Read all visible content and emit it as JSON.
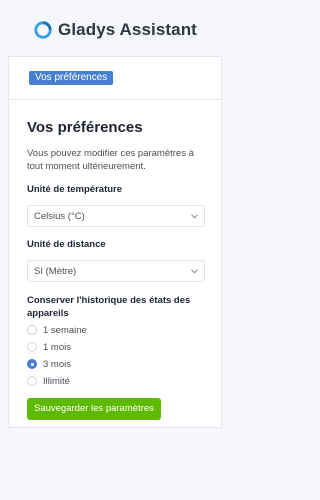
{
  "brand": {
    "name": "Gladys Assistant",
    "logo_icon": "gladys-logo-icon"
  },
  "header": {
    "badge": "Vos préférences"
  },
  "page": {
    "title": "Vos préférences",
    "description": "Vous pouvez modifier ces paramètres à tout moment ultérieurement."
  },
  "temperature": {
    "label": "Unité de température",
    "selected": "Celsius (°C)"
  },
  "distance": {
    "label": "Unité de distance",
    "selected": "SI (Mètre)"
  },
  "history": {
    "label": "Conserver l'historique des états des appareils",
    "options": [
      "1 semaine",
      "1 mois",
      "3 mois",
      "Illimité"
    ],
    "selected_index": 2
  },
  "save_label": "Sauvegarder les paramètres",
  "colors": {
    "accent": "#467fcf",
    "success": "#5eba00"
  }
}
